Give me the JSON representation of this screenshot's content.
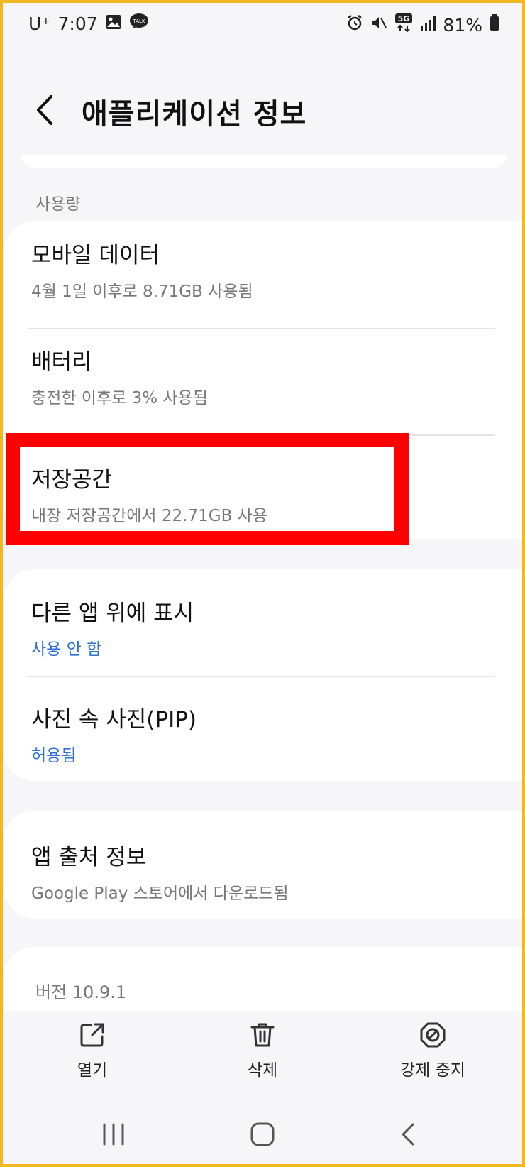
{
  "status_bar": {
    "carrier": "U⁺",
    "time": "7:07",
    "network": "5G",
    "battery": "81%"
  },
  "header": {
    "title": "애플리케이션 정보"
  },
  "usage_section": {
    "label": "사용량",
    "items": [
      {
        "title": "모바일 데이터",
        "subtitle": "4월 1일 이후로 8.71GB 사용됨"
      },
      {
        "title": "배터리",
        "subtitle": "충전한 이후로 3% 사용됨"
      },
      {
        "title": "저장공간",
        "subtitle": "내장 저장공간에서 22.71GB 사용"
      }
    ]
  },
  "permissions_section": {
    "items": [
      {
        "title": "다른 앱 위에 표시",
        "subtitle": "사용 안 함"
      },
      {
        "title": "사진 속 사진(PIP)",
        "subtitle": "허용됨"
      }
    ]
  },
  "source_section": {
    "items": [
      {
        "title": "앱 출처 정보",
        "subtitle": "Google Play 스토어에서 다운로드됨"
      }
    ]
  },
  "version": "버전 10.9.1",
  "actions": {
    "open_label": "열기",
    "delete_label": "삭제",
    "force_stop_label": "강제 중지"
  },
  "colors": {
    "highlight": "#ff0000",
    "link_blue": "#2f6fd6",
    "frame": "#f2b823"
  },
  "icons": {
    "open": "open-external-icon",
    "delete": "trash-icon",
    "force_stop": "stop-icon"
  }
}
